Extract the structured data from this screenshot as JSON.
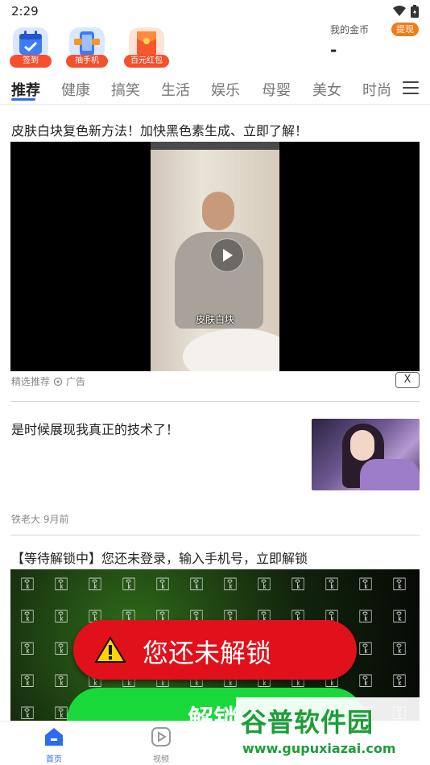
{
  "status_bar": {
    "time": "2:29"
  },
  "quick_actions": [
    {
      "label": "签到",
      "icon": "calendar-icon"
    },
    {
      "label": "抽手机",
      "icon": "phone-gift-icon"
    },
    {
      "label": "百元红包",
      "icon": "red-envelope-icon"
    }
  ],
  "coins": {
    "label": "我的金币",
    "withdraw_label": "提现",
    "value": "-"
  },
  "tabs": [
    "推荐",
    "健康",
    "搞笑",
    "生活",
    "娱乐",
    "母婴",
    "美女",
    "时尚"
  ],
  "active_tab": "推荐",
  "feed": {
    "ad": {
      "title": "皮肤白块复色新方法！加快黑色素生成、立即了解！",
      "caption": "皮肤白块",
      "meta_source": "精选推荐",
      "meta_ad": "广告",
      "close_label": "X"
    },
    "article": {
      "title": "是时候展现我真正的技术了！",
      "meta": "铁老大 9月前"
    },
    "lock": {
      "title": "【等待解锁中】您还未登录，输入手机号，立即解锁",
      "banner_text": "您还未解锁",
      "button_label": "解锁"
    }
  },
  "bottom_nav": [
    {
      "label": "首页",
      "icon": "home-icon",
      "active": true
    },
    {
      "label": "视频",
      "icon": "video-icon",
      "active": false
    }
  ],
  "watermark": {
    "brand": "谷普软件园",
    "url": "www.gupuxiazai.com"
  },
  "colors": {
    "accent": "#2b6cf0",
    "badge": "#f4502e",
    "withdraw": "#f47a14",
    "lock_red": "#e1111b",
    "lock_green": "#19d93a"
  }
}
